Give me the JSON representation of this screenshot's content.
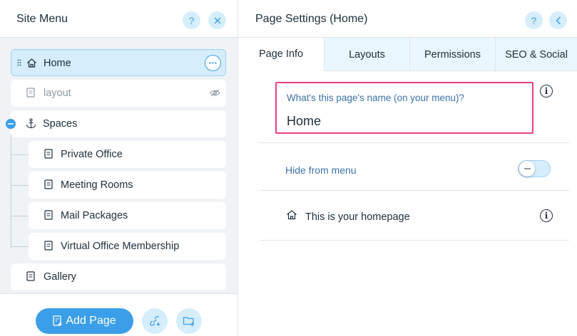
{
  "site_menu": {
    "title": "Site Menu",
    "help_label": "?",
    "items": [
      {
        "label": "Home",
        "icon": "home-icon",
        "selected": true
      },
      {
        "label": "layout",
        "icon": "page-icon",
        "hidden": true
      },
      {
        "label": "Spaces",
        "icon": "anchor-icon",
        "collapsible": true
      },
      {
        "label": "Private Office",
        "icon": "page-icon"
      },
      {
        "label": "Meeting Rooms",
        "icon": "page-icon"
      },
      {
        "label": "Mail Packages",
        "icon": "page-icon"
      },
      {
        "label": "Virtual Office Membership",
        "icon": "page-icon"
      },
      {
        "label": "Gallery",
        "icon": "page-icon"
      }
    ],
    "add_page_label": "Add Page"
  },
  "page_settings": {
    "title": "Page Settings (Home)",
    "help_label": "?",
    "tabs": [
      {
        "label": "Page Info",
        "active": true
      },
      {
        "label": "Layouts"
      },
      {
        "label": "Permissions"
      },
      {
        "label": "SEO & Social"
      }
    ],
    "name_question": "What's this page's name (on your menu)?",
    "name_value": "Home",
    "hide_from_menu_label": "Hide from menu",
    "hide_from_menu_on": false,
    "homepage_label": "This is your homepage"
  },
  "colors": {
    "accent": "#3b9ee9",
    "accent_light": "#d6eefc",
    "highlight_border": "#ee3d83",
    "panel_bg": "#eff3f6"
  }
}
